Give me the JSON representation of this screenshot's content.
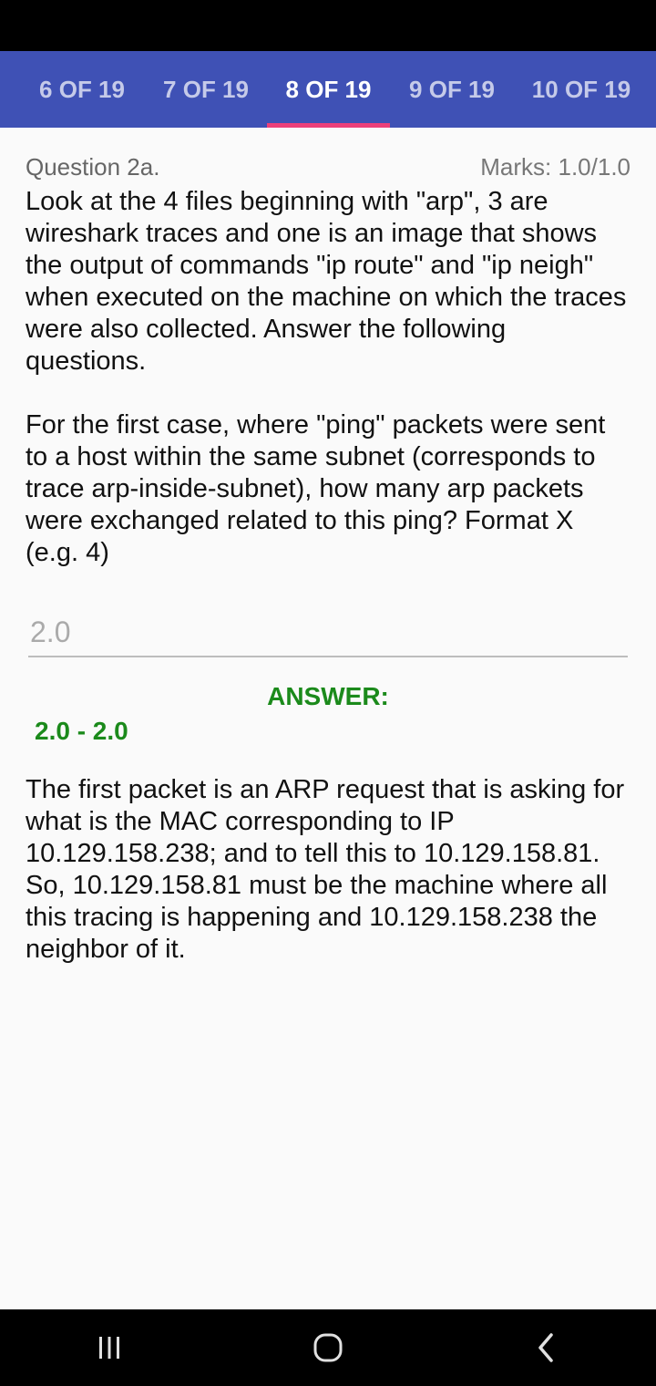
{
  "tabs": [
    {
      "label": "6 OF 19"
    },
    {
      "label": "7 OF 19"
    },
    {
      "label": "8 OF 19",
      "active": true
    },
    {
      "label": "9 OF 19"
    },
    {
      "label": "10 OF 19"
    }
  ],
  "question": {
    "label": "Question 2a.",
    "marks": "Marks: 1.0/1.0",
    "text": "Look at the 4 files beginning with \"arp\", 3 are wireshark traces and one is an image that shows the output of commands \"ip route\" and \"ip neigh\" when executed on the machine on which the traces were also collected. Answer the following questions.\n\nFor the first case, where \"ping\" packets were sent to a host within the same subnet (corresponds to trace arp-inside-subnet), how many arp packets were exchanged related to this ping? Format X (e.g. 4)"
  },
  "answer": {
    "input_value": "2.0",
    "heading": "ANSWER:",
    "range": "2.0 - 2.0",
    "explanation": "The first packet is an ARP request that is asking for what is the MAC corresponding to IP 10.129.158.238; and to tell this to 10.129.158.81. So, 10.129.158.81 must be the machine where all this tracing is happening and 10.129.158.238 the neighbor of it."
  },
  "colors": {
    "tab_bar": "#3f51b5",
    "tab_indicator": "#ec407a",
    "answer_green": "#1b8a1b"
  },
  "icons": {
    "recents": "recents-icon",
    "home": "home-icon",
    "back": "back-icon"
  }
}
